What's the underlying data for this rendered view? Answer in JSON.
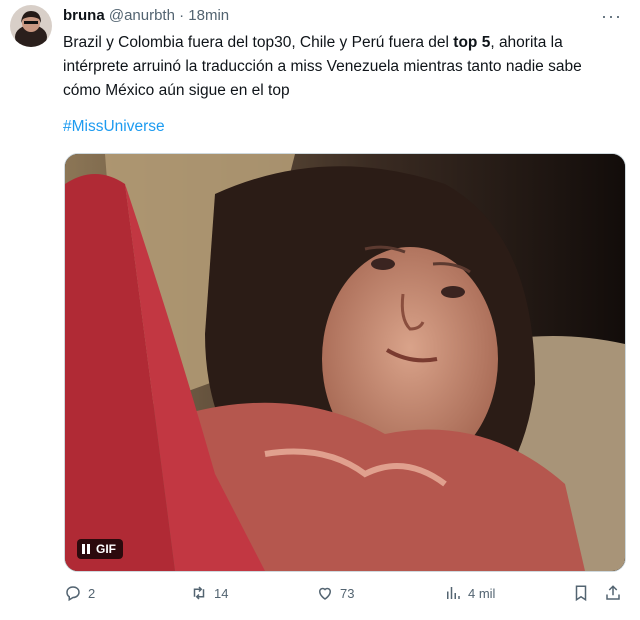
{
  "tweet": {
    "author_name": "bruna",
    "handle": "@anurbth",
    "separator": "·",
    "time": "18min",
    "text_part1": "Brazil y Colombia fuera del top30, Chile y Perú fuera del ",
    "text_bold": "top 5",
    "text_part2": ", ahorita la intérprete arruinó la traducción a miss Venezuela mientras tanto nadie sabe cómo México aún sigue en el top",
    "hashtag": "#MissUniverse",
    "more_icon": "···"
  },
  "media": {
    "badge_label": "GIF"
  },
  "actions": {
    "replies": "2",
    "retweets": "14",
    "likes": "73",
    "views": "4 mil"
  },
  "colors": {
    "link": "#1d9bf0",
    "secondary": "#536471",
    "text": "#0f1419"
  },
  "icons": [
    "reply-icon",
    "retweet-icon",
    "like-icon",
    "views-icon",
    "bookmark-icon",
    "share-icon",
    "more-icon",
    "pause-icon"
  ]
}
